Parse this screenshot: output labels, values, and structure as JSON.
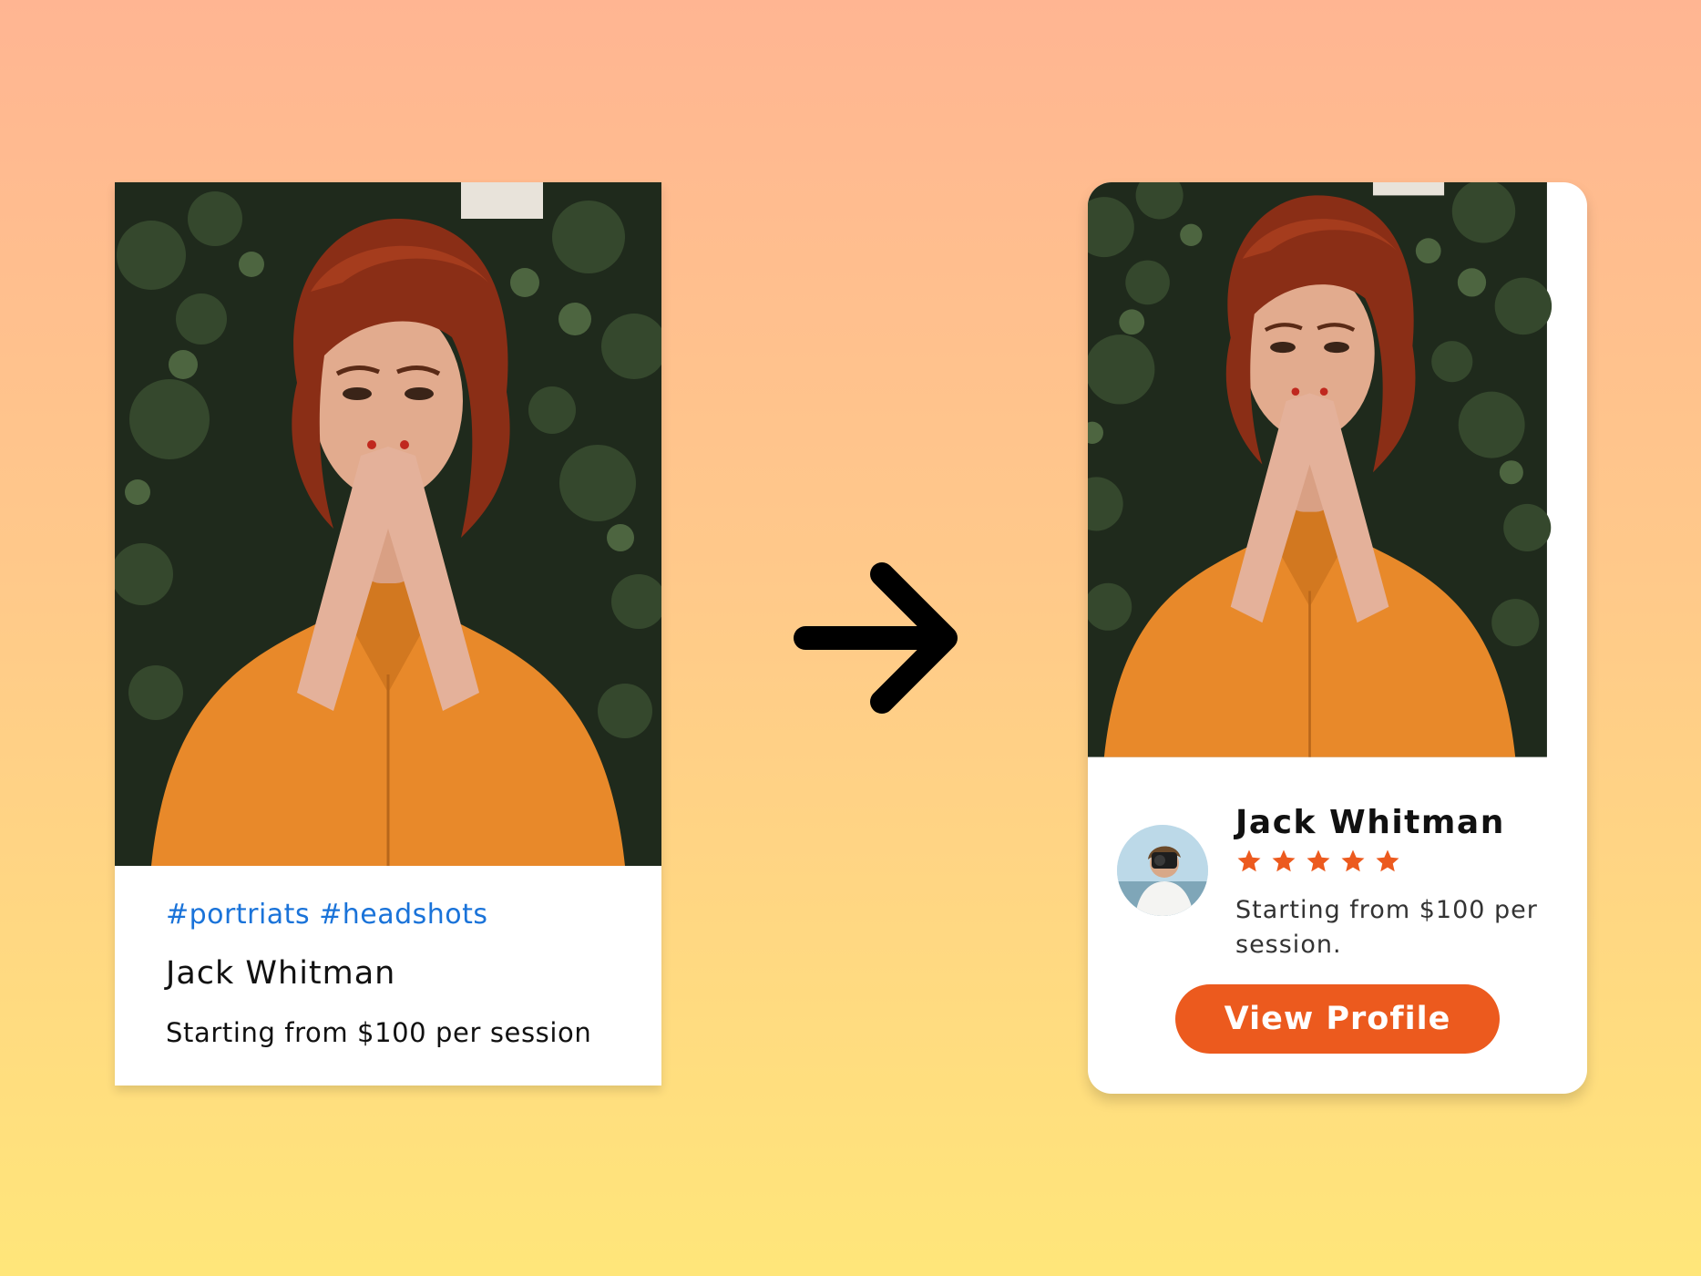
{
  "before_card": {
    "tags": "#portriats #headshots",
    "name": "Jack Whitman",
    "price_text": "Starting from $100 per session"
  },
  "after_card": {
    "name": "Jack Whitman",
    "rating": 5,
    "price_text": "Starting from $100 per session.",
    "button_label": "View Profile",
    "star_color": "#ec5a1e"
  },
  "colors": {
    "tag_blue": "#1a73d9",
    "accent_orange": "#ec5a1e"
  }
}
